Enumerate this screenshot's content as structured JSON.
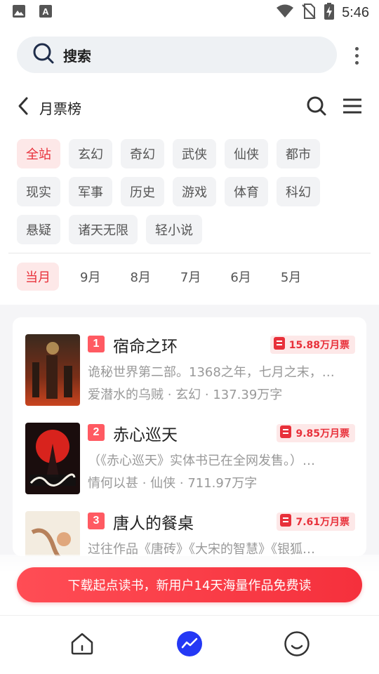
{
  "status_bar": {
    "time": "5:46",
    "icons": [
      "image-icon",
      "app-a-icon",
      "wifi-icon",
      "no-sim-icon",
      "battery-charging-icon"
    ]
  },
  "search": {
    "label": "搜索",
    "icon": "search-icon"
  },
  "header": {
    "title": "月票榜",
    "back_icon": "back-arrow-icon",
    "search_icon": "search-icon",
    "menu_icon": "menu-icon"
  },
  "categories": [
    {
      "label": "全站",
      "active": true
    },
    {
      "label": "玄幻",
      "active": false
    },
    {
      "label": "奇幻",
      "active": false
    },
    {
      "label": "武侠",
      "active": false
    },
    {
      "label": "仙侠",
      "active": false
    },
    {
      "label": "都市",
      "active": false
    },
    {
      "label": "现实",
      "active": false
    },
    {
      "label": "军事",
      "active": false
    },
    {
      "label": "历史",
      "active": false
    },
    {
      "label": "游戏",
      "active": false
    },
    {
      "label": "体育",
      "active": false
    },
    {
      "label": "科幻",
      "active": false
    },
    {
      "label": "悬疑",
      "active": false
    },
    {
      "label": "诸天无限",
      "active": false
    },
    {
      "label": "轻小说",
      "active": false
    }
  ],
  "months": [
    {
      "label": "当月",
      "active": true
    },
    {
      "label": "9月",
      "active": false
    },
    {
      "label": "8月",
      "active": false
    },
    {
      "label": "7月",
      "active": false
    },
    {
      "label": "6月",
      "active": false
    },
    {
      "label": "5月",
      "active": false
    }
  ],
  "books": [
    {
      "rank": "1",
      "title": "宿命之环",
      "votes": "15.88万月票",
      "desc": "诡秘世界第二部。1368之年，七月之末，…",
      "meta": "爱潜水的乌贼 · 玄幻 · 137.39万字"
    },
    {
      "rank": "2",
      "title": "赤心巡天",
      "votes": "9.85万月票",
      "desc": "（《赤心巡天》实体书已在全网发售。）…",
      "meta": "情何以甚 · 仙侠 · 711.97万字"
    },
    {
      "rank": "3",
      "title": "唐人的餐桌",
      "votes": "7.61万月票",
      "desc": "过往作品《唐砖》《大宋的智慧》《银狐…",
      "meta": ""
    }
  ],
  "cta": {
    "label": "下载起点读书，新用户14天海量作品免费读"
  },
  "bottom_nav": [
    {
      "name": "home",
      "icon": "home-icon",
      "active": false
    },
    {
      "name": "ranking",
      "icon": "trend-icon",
      "active": true
    },
    {
      "name": "profile",
      "icon": "smile-icon",
      "active": false
    }
  ],
  "colors": {
    "accent": "#e8303a",
    "accent_bg": "#fde8e8",
    "nav_active": "#2438f5"
  }
}
